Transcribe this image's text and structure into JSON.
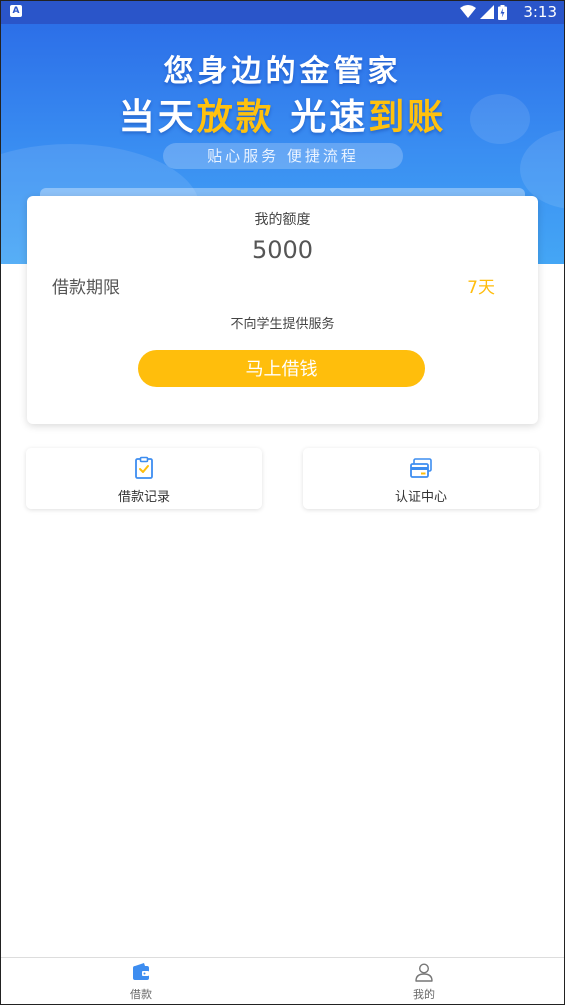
{
  "status_bar": {
    "notification_glyph": "A",
    "time": "3:13",
    "icons": [
      "wifi-icon",
      "signal-icon",
      "battery-icon"
    ]
  },
  "banner": {
    "headline": "您身边的金管家",
    "slogan_part1": "当天",
    "slogan_part2": "放款",
    "slogan_part3": "光速",
    "slogan_part4": "到账",
    "pill_text": "贴心服务 便捷流程"
  },
  "quota_card": {
    "label": "我的额度",
    "amount": "5000",
    "term_label": "借款期限",
    "term_value": "7天",
    "notice": "不向学生提供服务",
    "button_label": "马上借钱"
  },
  "features": {
    "records_label": "借款记录",
    "verify_label": "认证中心"
  },
  "bottom_nav": {
    "loan_label": "借款",
    "mine_label": "我的"
  },
  "colors": {
    "accent_yellow": "#ffbe0c",
    "banner_blue": "#2c6fe8",
    "status_bar": "#2a55c9",
    "nav_active": "#3d8df0"
  }
}
